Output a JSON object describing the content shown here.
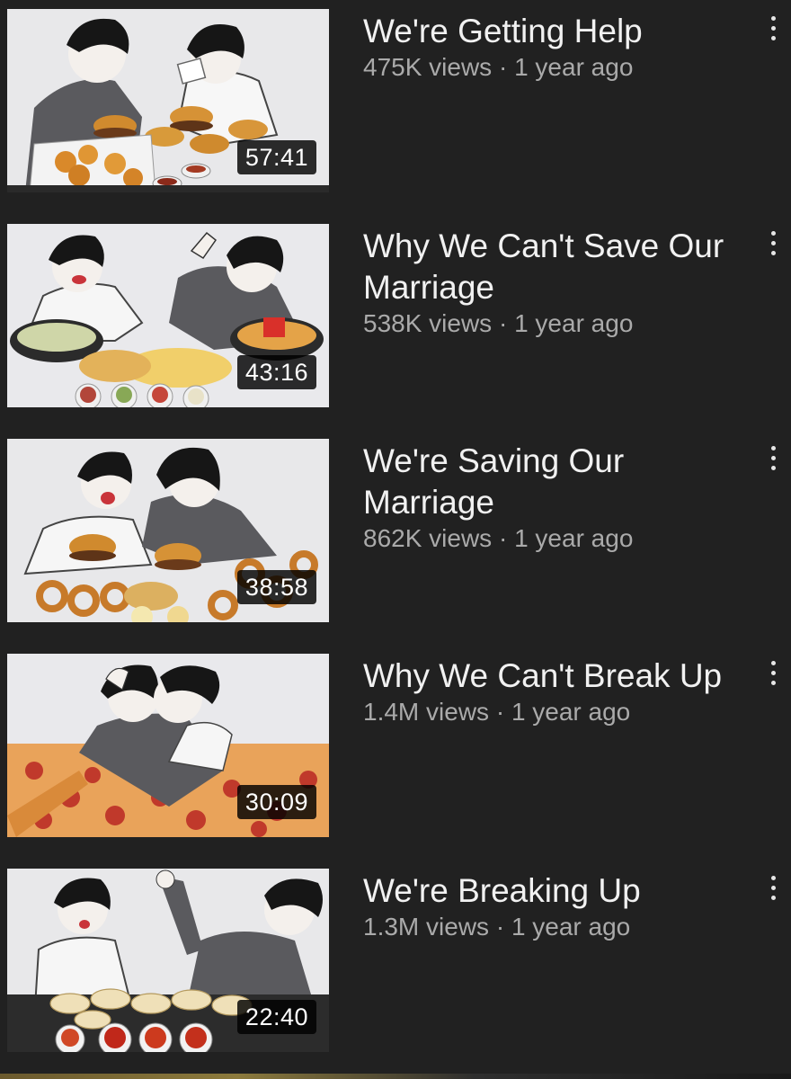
{
  "videos": [
    {
      "title": "We're Getting Help",
      "views": "475K views",
      "age": "1 year ago",
      "duration": "57:41",
      "food": "burgers-nuggets"
    },
    {
      "title": "Why We Can't Save Our Marriage",
      "views": "538K views",
      "age": "1 year ago",
      "duration": "43:16",
      "food": "salad-fries-sauces"
    },
    {
      "title": "We're Saving Our Marriage",
      "views": "862K views",
      "age": "1 year ago",
      "duration": "38:58",
      "food": "burgers-onion-rings"
    },
    {
      "title": "Why We Can't Break Up",
      "views": "1.4M views",
      "age": "1 year ago",
      "duration": "30:09",
      "food": "pizza"
    },
    {
      "title": "We're Breaking Up",
      "views": "1.3M views",
      "age": "1 year ago",
      "duration": "22:40",
      "food": "dumplings-sauces"
    }
  ],
  "separator": "·",
  "icons": {
    "more": "more-vert-icon"
  },
  "colors": {
    "background": "#212121",
    "title": "#f1f1f1",
    "meta": "#aaaaaa",
    "duration_bg": "#000000"
  }
}
